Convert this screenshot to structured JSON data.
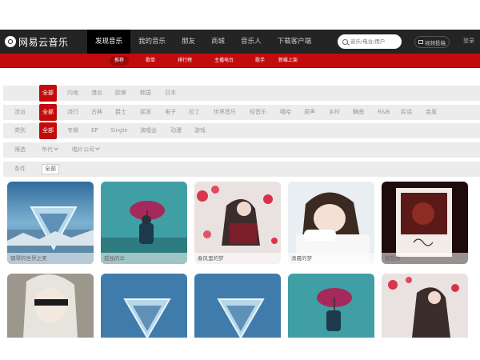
{
  "brand": {
    "logo_text": "网易云音乐",
    "logo_icon": "netease-music-icon"
  },
  "nav": [
    "发现音乐",
    "我的音乐",
    "朋友",
    "商城",
    "音乐人",
    "下载客户端"
  ],
  "nav_active": "发现音乐",
  "search": {
    "placeholder": "音乐/电台/用户"
  },
  "upload_label": "视频投稿",
  "login_label": "登录",
  "subnav": [
    "推荐",
    "歌单",
    "排行榜",
    "主播电台",
    "歌手",
    "新碟上架"
  ],
  "subnav_active": "推荐",
  "filters": {
    "region": {
      "label": "",
      "options": [
        "全部",
        "内地",
        "港台",
        "欧美",
        "韩国",
        "日本"
      ]
    },
    "genre": {
      "label": "流派",
      "options": [
        "全部",
        "流行",
        "古典",
        "爵士",
        "摇滚",
        "电子",
        "拉丁",
        "世界音乐",
        "轻音乐",
        "嘻哈",
        "原声",
        "乡村",
        "舞曲",
        "R&B",
        "民谣",
        "金属"
      ]
    },
    "type": {
      "label": "类别",
      "options": [
        "全部",
        "专辑",
        "EP",
        "Single",
        "演唱会",
        "动漫",
        "游戏"
      ]
    },
    "sort": {
      "label": "筛选",
      "options": [
        "年代",
        "唱片公司"
      ]
    },
    "condition": {
      "label": "条件",
      "value": "全部"
    }
  },
  "albums_row1": [
    "钢琴的世界之美",
    "孤独的伞",
    "春风里的梦",
    "清晨的梦",
    "我想你"
  ],
  "colors": {
    "brand_red": "#c20c0c",
    "topbar": "#242424",
    "filter_bg": "#ececec"
  }
}
